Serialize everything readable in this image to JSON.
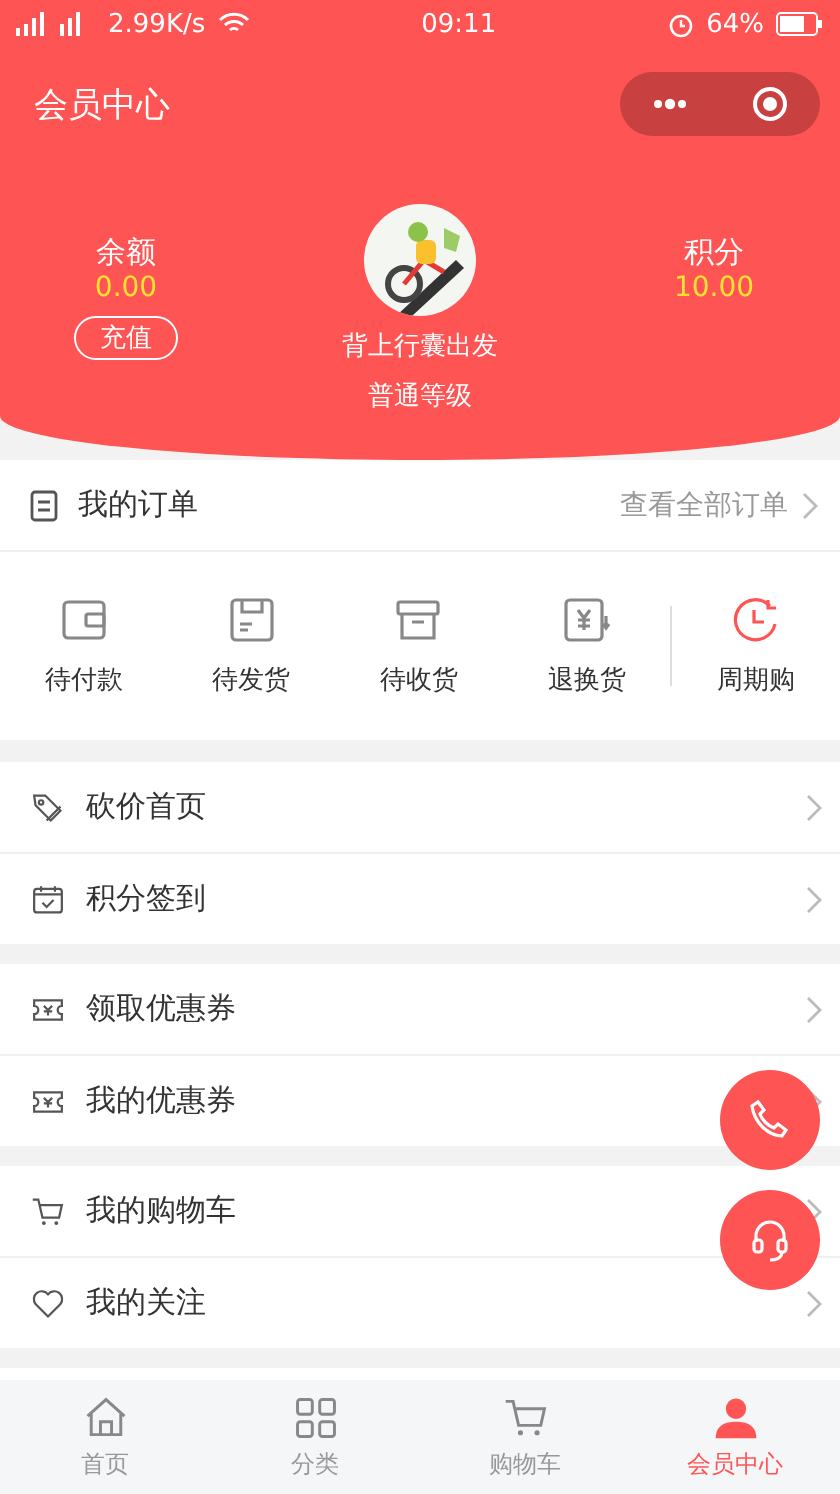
{
  "status_bar": {
    "speed": "2.99K/s",
    "time": "09:11",
    "battery": "64%"
  },
  "nav": {
    "title": "会员中心"
  },
  "profile": {
    "balance": {
      "label": "余额",
      "value": "0.00",
      "button": "充值"
    },
    "user": {
      "name": "背上行囊出发",
      "level": "普通等级"
    },
    "points": {
      "label": "积分",
      "value": "10.00"
    }
  },
  "orders": {
    "title": "我的订单",
    "link": "查看全部订单",
    "statuses": [
      {
        "label": "待付款",
        "kind": "wallet"
      },
      {
        "label": "待发货",
        "kind": "box"
      },
      {
        "label": "待收货",
        "kind": "archive"
      },
      {
        "label": "退换货",
        "kind": "refund"
      },
      {
        "label": "周期购",
        "kind": "cycle"
      }
    ]
  },
  "menu_groups": [
    [
      {
        "label": "砍价首页",
        "kind": "tag"
      },
      {
        "label": "积分签到",
        "kind": "calendar"
      }
    ],
    [
      {
        "label": "领取优惠券",
        "kind": "coupon"
      },
      {
        "label": "我的优惠券",
        "kind": "coupon"
      }
    ],
    [
      {
        "label": "我的购物车",
        "kind": "cart"
      },
      {
        "label": "我的关注",
        "kind": "heart"
      }
    ]
  ],
  "tabs": [
    {
      "label": "首页",
      "kind": "home",
      "selected": false
    },
    {
      "label": "分类",
      "kind": "grid",
      "selected": false
    },
    {
      "label": "购物车",
      "kind": "cart",
      "selected": false
    },
    {
      "label": "会员中心",
      "kind": "user",
      "selected": true
    }
  ]
}
